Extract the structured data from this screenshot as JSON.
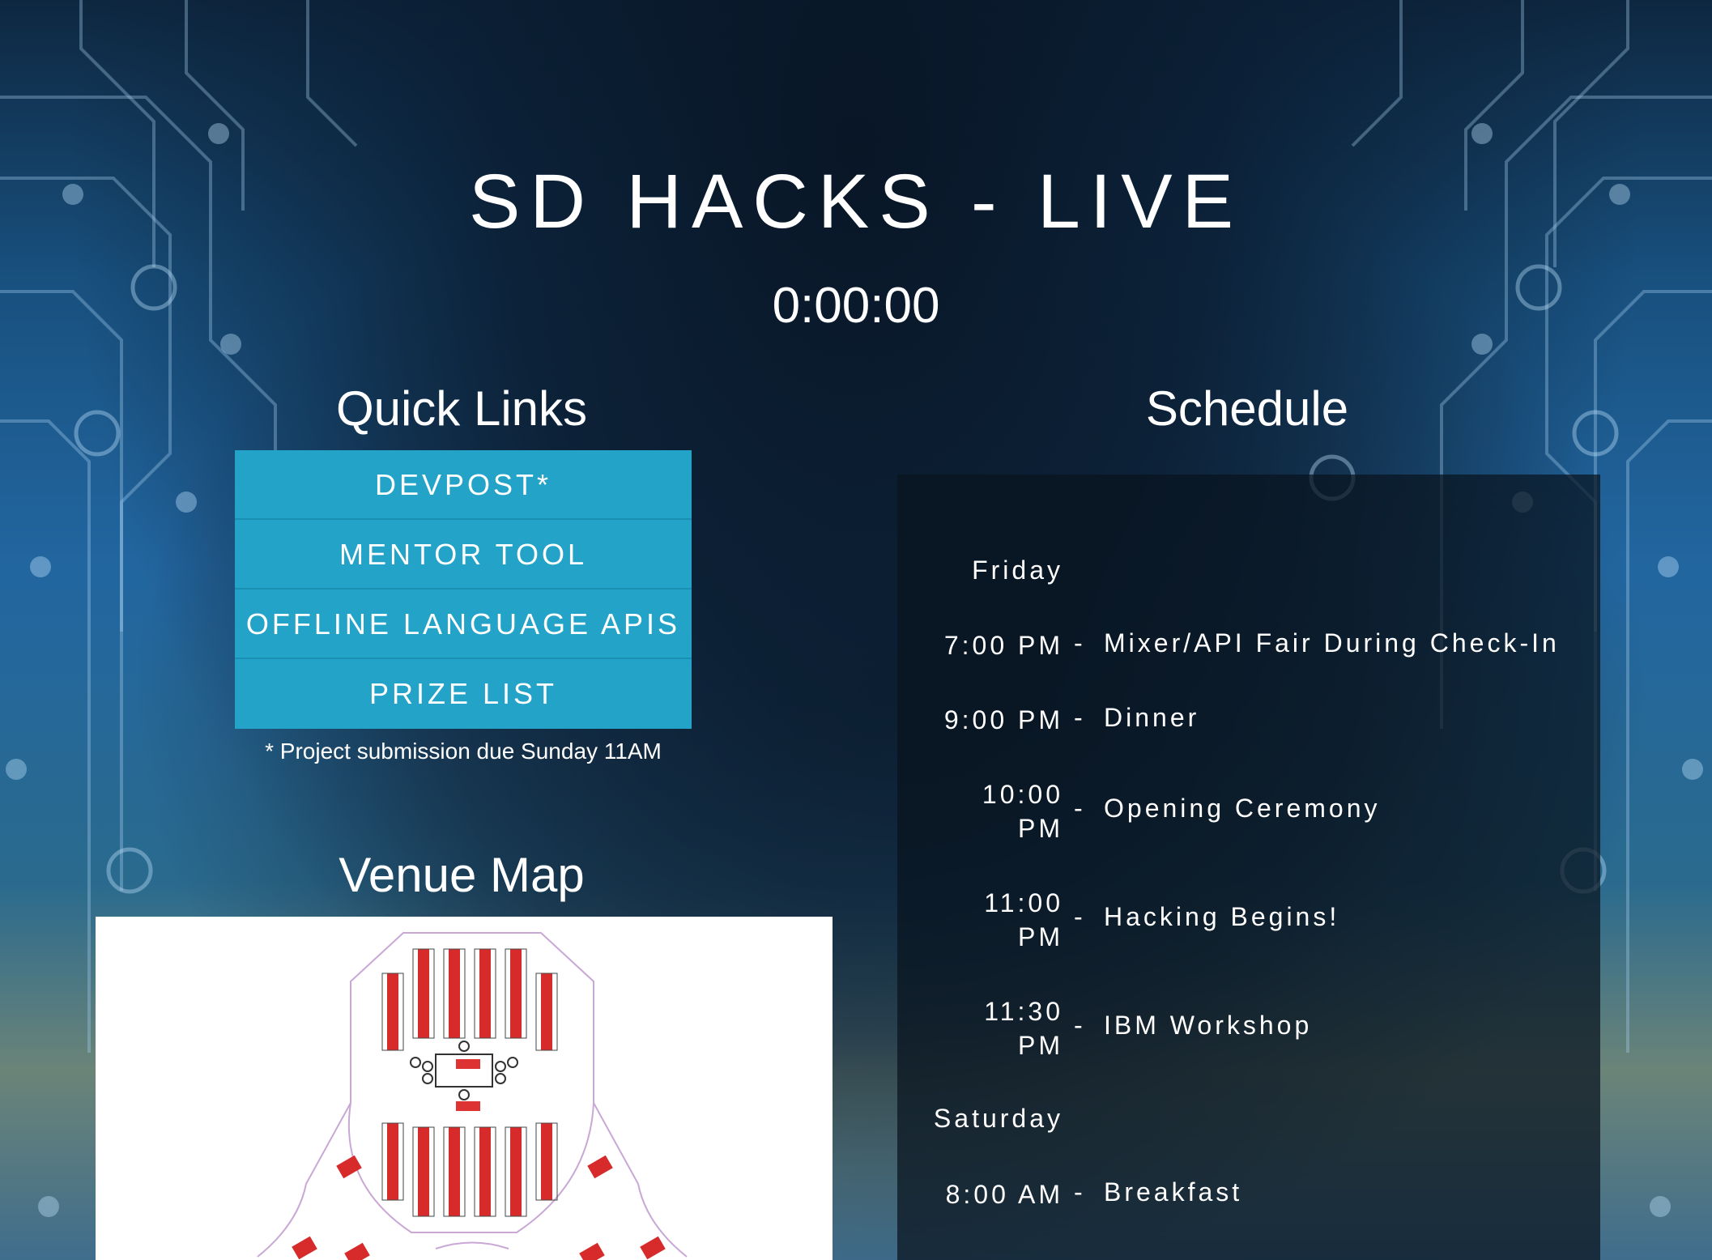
{
  "header": {
    "title": "SD HACKS - LIVE",
    "countdown": "0:00:00"
  },
  "quick_links": {
    "heading": "Quick Links",
    "items": [
      {
        "label": "DEVPOST*"
      },
      {
        "label": "MENTOR TOOL"
      },
      {
        "label": "OFFLINE LANGUAGE APIS"
      },
      {
        "label": "PRIZE LIST"
      }
    ],
    "note": "* Project submission due Sunday 11AM"
  },
  "venue_map": {
    "heading": "Venue Map"
  },
  "schedule": {
    "heading": "Schedule",
    "days": [
      {
        "day": "Friday",
        "events": [
          {
            "time": "7:00 PM",
            "event": "Mixer/API Fair During Check-In"
          },
          {
            "time": "9:00 PM",
            "event": "Dinner"
          },
          {
            "time_line1": "10:00",
            "time_line2": "PM",
            "event": "Opening Ceremony"
          },
          {
            "time_line1": "11:00",
            "time_line2": "PM",
            "event": "Hacking Begins!"
          },
          {
            "time_line1": "11:30",
            "time_line2": "PM",
            "event": "IBM Workshop"
          }
        ]
      },
      {
        "day": "Saturday",
        "events": [
          {
            "time": "8:00 AM",
            "event": "Breakfast"
          }
        ]
      }
    ],
    "dash": "-"
  }
}
